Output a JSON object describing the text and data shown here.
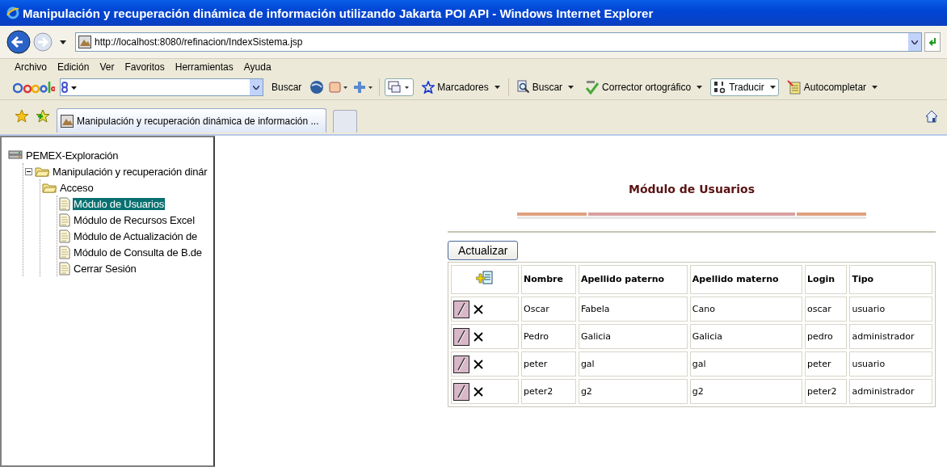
{
  "window": {
    "title": "Manipulación y recuperación dinámica de información utilizando Jakarta POI API - Windows Internet Explorer"
  },
  "address_bar": {
    "url": "http://localhost:8080/refinacion/IndexSistema.jsp"
  },
  "menu": [
    "Archivo",
    "Edición",
    "Ver",
    "Favoritos",
    "Herramientas",
    "Ayuda"
  ],
  "google_toolbar": {
    "search_button": "Buscar",
    "items": [
      {
        "label": "Marcadores",
        "kind": "star"
      },
      {
        "label": "Buscar",
        "kind": "magnifier"
      },
      {
        "label": "Corrector ortográfico",
        "kind": "spell"
      },
      {
        "label": "Traducir",
        "kind": "translate"
      },
      {
        "label": "Autocompletar",
        "kind": "notepad"
      }
    ]
  },
  "tabs": [
    {
      "label": "Manipulación y recuperación dinámica de información ...",
      "selected": true
    }
  ],
  "tree": [
    {
      "label": "PEMEX-Exploración",
      "kind": "server",
      "children": [
        {
          "label": "Manipulación y recuperación dinár",
          "kind": "folder",
          "expanded": true,
          "children": [
            {
              "label": "Acceso",
              "kind": "folder",
              "children": [
                {
                  "label": "Módulo de Usuarios",
                  "kind": "page",
                  "selected": true
                },
                {
                  "label": "Módulo de Recursos Excel",
                  "kind": "page",
                  "selected": false
                },
                {
                  "label": "Módulo de Actualización de",
                  "kind": "page",
                  "selected": false
                },
                {
                  "label": "Módulo de Consulta de B.de",
                  "kind": "page",
                  "selected": false
                },
                {
                  "label": "Cerrar Sesión",
                  "kind": "page",
                  "selected": false
                }
              ]
            }
          ]
        }
      ]
    }
  ],
  "page": {
    "heading": "Módulo de Usuarios",
    "refresh_button": "Actualizar",
    "table": {
      "columns": [
        "Nombre",
        "Apellido paterno",
        "Apellido materno",
        "Login",
        "Tipo"
      ],
      "rows": [
        [
          "Oscar",
          "Fabela",
          "Cano",
          "oscar",
          "usuario"
        ],
        [
          "Pedro",
          "Galicia",
          "Galicia",
          "pedro",
          "administrador"
        ],
        [
          "peter",
          "gal",
          "gal",
          "peter",
          "usuario"
        ],
        [
          "peter2",
          "g2",
          "g2",
          "peter2",
          "administrador"
        ]
      ]
    }
  }
}
